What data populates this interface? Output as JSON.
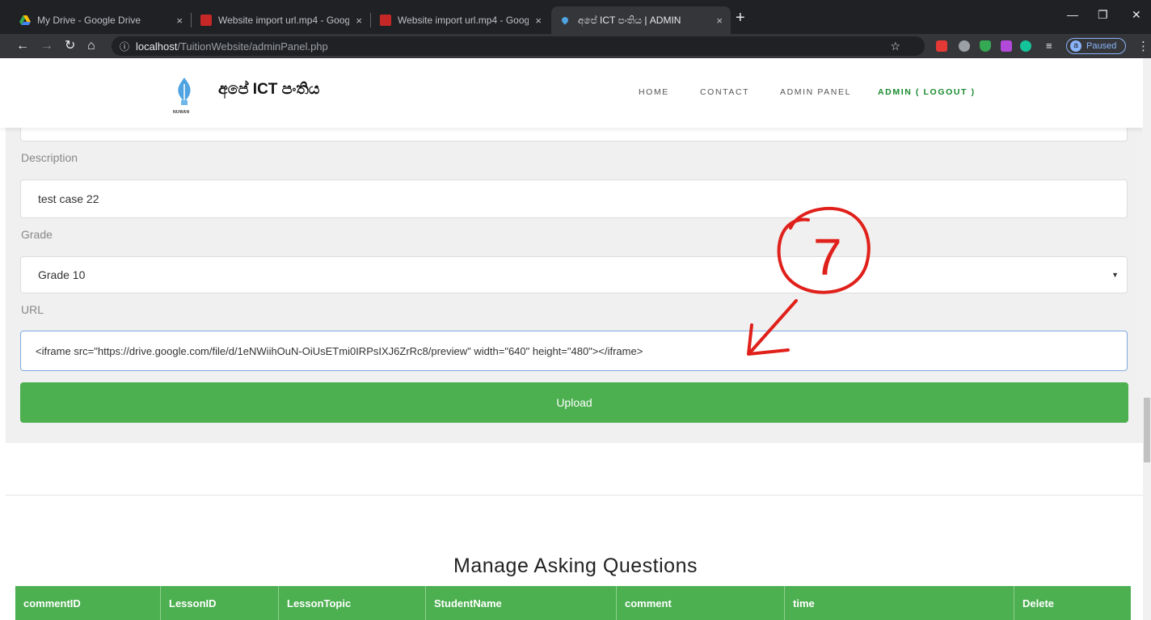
{
  "browser": {
    "tabs": [
      {
        "title": "My Drive - Google Drive",
        "close": "×"
      },
      {
        "title": "Website import url.mp4 - Google",
        "close": "×"
      },
      {
        "title": "Website import url.mp4 - Google",
        "close": "×"
      },
      {
        "title": "අපේ ICT පංතිය | ADMIN",
        "close": "×"
      }
    ],
    "new_tab": "+",
    "address": {
      "host": "localhost",
      "path": "/TuitionWebsite/adminPanel.php"
    },
    "profile": {
      "initial": "a",
      "status": "Paused"
    },
    "icons": [
      "back-arrow-icon",
      "forward-arrow-icon",
      "reload-icon",
      "home-icon",
      "info-icon",
      "star-icon",
      "menu-icon"
    ],
    "extension_colors": [
      "#e53935",
      "#9aa0a6",
      "#34a853",
      "#b14ad8",
      "#15c39a"
    ]
  },
  "site": {
    "brand": "අපේ ICT පංතිය",
    "logo_caption": "NUWAN",
    "nav": {
      "home": "HOME",
      "contact": "CONTACT",
      "admin_panel": "ADMIN PANEL",
      "admin_logout": "ADMIN ( LOGOUT )"
    },
    "accent": "#1a8a2e"
  },
  "form": {
    "description_label": "Description",
    "description_value": "test case 22",
    "grade_label": "Grade",
    "grade_value": "Grade 10",
    "url_label": "URL",
    "url_value": "<iframe src=\"https://drive.google.com/file/d/1eNWiihOuN-OiUsETmi0IRPsIXJ6ZrRc8/preview\" width=\"640\" height=\"480\"></iframe>",
    "upload_label": "Upload",
    "button_color": "#4caf50"
  },
  "annotation": {
    "number": "7",
    "color": "#e0201b"
  },
  "questions": {
    "title": "Manage Asking Questions",
    "columns": [
      "commentID",
      "LessonID",
      "LessonTopic",
      "StudentName",
      "comment",
      "time",
      "Delete"
    ]
  }
}
